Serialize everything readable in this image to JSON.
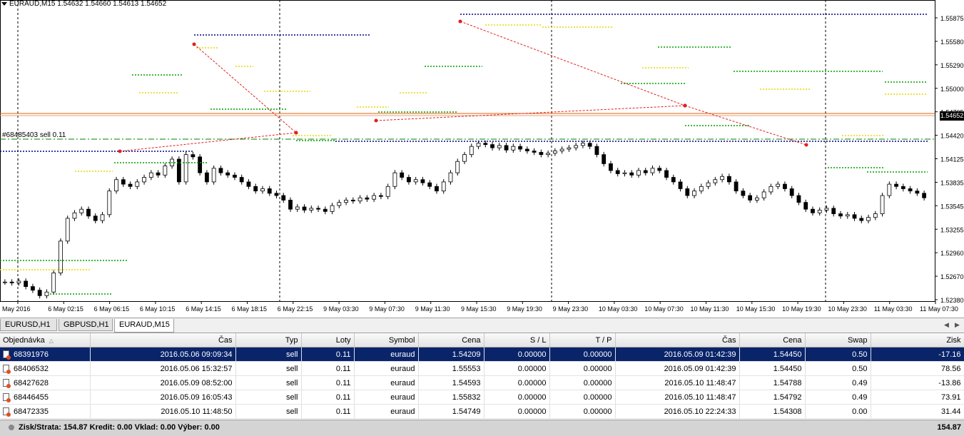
{
  "chart": {
    "title": "EURAUD,M15  1.54632 1.54660 1.54613 1.54652",
    "order_label": "#68485403 sell 0.11",
    "current_price": "1.54652",
    "price_labels": [
      "1.55875",
      "1.55580",
      "1.55290",
      "1.55000",
      "1.54705",
      "1.54420",
      "1.54125",
      "1.53835",
      "1.53545",
      "1.53255",
      "1.52960",
      "1.52670",
      "1.52380"
    ],
    "time_labels": [
      "May 2016",
      "6 May 02:15",
      "6 May 06:15",
      "6 May 10:15",
      "6 May 14:15",
      "6 May 18:15",
      "6 May 22:15",
      "9 May 03:30",
      "9 May 07:30",
      "9 May 11:30",
      "9 May 15:30",
      "9 May 19:30",
      "9 May 23:30",
      "10 May 03:30",
      "10 May 07:30",
      "10 May 11:30",
      "10 May 15:30",
      "10 May 19:30",
      "10 May 23:30",
      "11 May 03:30",
      "11 May 07:30"
    ],
    "price_range": [
      1.5238,
      1.5895
    ],
    "close_series": [
      1.528,
      1.5278,
      1.5282,
      1.527,
      1.5262,
      1.525,
      1.5258,
      1.53,
      1.537,
      1.542,
      1.5432,
      1.544,
      1.5425,
      1.5415,
      1.5428,
      1.548,
      1.5505,
      1.5495,
      1.549,
      1.55,
      1.551,
      1.552,
      1.5515,
      1.5535,
      1.555,
      1.55,
      1.556,
      1.5555,
      1.552,
      1.55,
      1.553,
      1.552,
      1.5515,
      1.551,
      1.55,
      1.549,
      1.548,
      1.5485,
      1.5475,
      1.547,
      1.546,
      1.544,
      1.5445,
      1.5438,
      1.5442,
      1.544,
      1.5435,
      1.5448,
      1.5455,
      1.546,
      1.5458,
      1.5465,
      1.5462,
      1.547,
      1.5468,
      1.549,
      1.552,
      1.551,
      1.55,
      1.5505,
      1.5498,
      1.549,
      1.548,
      1.55,
      1.552,
      1.5545,
      1.556,
      1.5578,
      1.5585,
      1.5582,
      1.5575,
      1.558,
      1.557,
      1.5578,
      1.5572,
      1.5568,
      1.5565,
      1.556,
      1.5563,
      1.5568,
      1.5572,
      1.5575,
      1.558,
      1.5585,
      1.5578,
      1.556,
      1.554,
      1.5525,
      1.5518,
      1.552,
      1.5515,
      1.5525,
      1.552,
      1.553,
      1.5525,
      1.551,
      1.55,
      1.5485,
      1.547,
      1.548,
      1.549,
      1.5498,
      1.5505,
      1.5512,
      1.55,
      1.548,
      1.547,
      1.546,
      1.5465,
      1.5478,
      1.549,
      1.5495,
      1.5485,
      1.547,
      1.5455,
      1.544,
      1.5432,
      1.5438,
      1.5442,
      1.543,
      1.5425,
      1.5428,
      1.542,
      1.5415,
      1.5422,
      1.543,
      1.547,
      1.5495,
      1.549,
      1.5485,
      1.548,
      1.5475,
      1.5465
    ]
  },
  "tabs": [
    {
      "label": "EURUSD,H1"
    },
    {
      "label": "GBPUSD,H1"
    },
    {
      "label": "EURAUD,M15"
    }
  ],
  "terminal": {
    "columns": [
      "Objednávka",
      "Čas",
      "Typ",
      "Loty",
      "Symbol",
      "Cena",
      "S / L",
      "T / P",
      "Čas",
      "Cena",
      "Swap",
      "Zisk"
    ],
    "rows": [
      {
        "order": "68391976",
        "open_time": "2016.05.06 09:09:34",
        "type": "sell",
        "lots": "0.11",
        "symbol": "euraud",
        "open_price": "1.54209",
        "sl": "0.00000",
        "tp": "0.00000",
        "close_time": "2016.05.09 01:42:39",
        "close_price": "1.54450",
        "swap": "0.50",
        "profit": "-17.16"
      },
      {
        "order": "68406532",
        "open_time": "2016.05.06 15:32:57",
        "type": "sell",
        "lots": "0.11",
        "symbol": "euraud",
        "open_price": "1.55553",
        "sl": "0.00000",
        "tp": "0.00000",
        "close_time": "2016.05.09 01:42:39",
        "close_price": "1.54450",
        "swap": "0.50",
        "profit": "78.56"
      },
      {
        "order": "68427628",
        "open_time": "2016.05.09 08:52:00",
        "type": "sell",
        "lots": "0.11",
        "symbol": "euraud",
        "open_price": "1.54593",
        "sl": "0.00000",
        "tp": "0.00000",
        "close_time": "2016.05.10 11:48:47",
        "close_price": "1.54788",
        "swap": "0.49",
        "profit": "-13.86"
      },
      {
        "order": "68446455",
        "open_time": "2016.05.09 16:05:43",
        "type": "sell",
        "lots": "0.11",
        "symbol": "euraud",
        "open_price": "1.55832",
        "sl": "0.00000",
        "tp": "0.00000",
        "close_time": "2016.05.10 11:48:47",
        "close_price": "1.54792",
        "swap": "0.49",
        "profit": "73.91"
      },
      {
        "order": "68472335",
        "open_time": "2016.05.10 11:48:50",
        "type": "sell",
        "lots": "0.11",
        "symbol": "euraud",
        "open_price": "1.54749",
        "sl": "0.00000",
        "tp": "0.00000",
        "close_time": "2016.05.10 22:24:33",
        "close_price": "1.54308",
        "swap": "0.00",
        "profit": "31.44"
      }
    ],
    "totals": {
      "summary": "Zisk/Strata: 154.87  Kredit: 0.00  Vklad: 0.00  Výber: 0.00",
      "total": "154.87"
    }
  },
  "colors": {
    "selected_row": "#0a246a",
    "bid_line": "#e06010",
    "trade_line": "#e02020",
    "level_green": "#00a000",
    "level_yellow": "#e8d800",
    "level_blue": "#000080"
  }
}
